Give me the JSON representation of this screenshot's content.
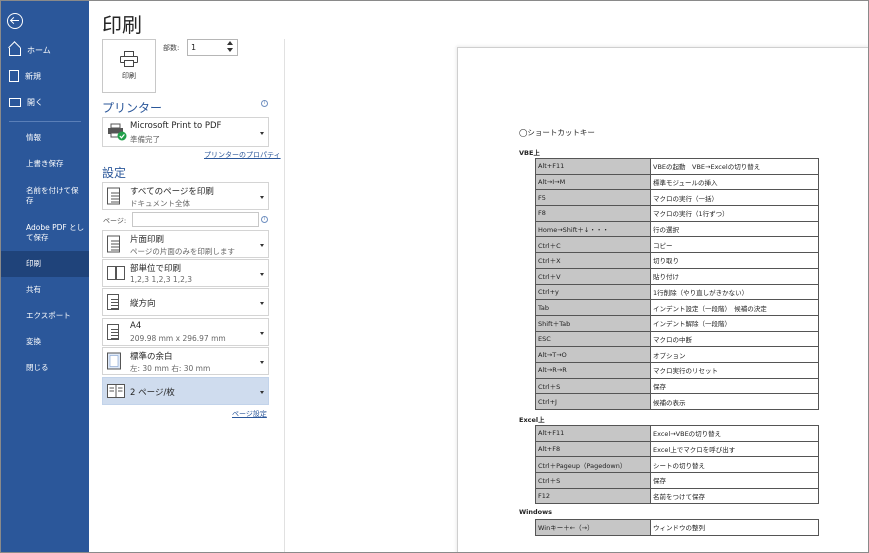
{
  "sidebar": {
    "top_items": [
      {
        "label": "ホーム",
        "icon": "home-icon"
      },
      {
        "label": "新規",
        "icon": "new-document-icon"
      },
      {
        "label": "開く",
        "icon": "folder-open-icon"
      }
    ],
    "items": [
      {
        "label": "情報"
      },
      {
        "label": "上書き保存"
      },
      {
        "label": "名前を付けて保存"
      },
      {
        "label": "Adobe PDF として保存"
      },
      {
        "label": "印刷",
        "active": true
      },
      {
        "label": "共有"
      },
      {
        "label": "エクスポート"
      },
      {
        "label": "変換"
      },
      {
        "label": "閉じる"
      }
    ],
    "bg_color": "#2b579a",
    "active_color": "#1f437a"
  },
  "page_title": "印刷",
  "print_button": {
    "label": "印刷"
  },
  "copies": {
    "label": "部数:",
    "value": "1"
  },
  "printer": {
    "section_title": "プリンター",
    "name": "Microsoft Print to PDF",
    "status": "準備完了",
    "properties_link": "プリンターのプロパティ"
  },
  "settings": {
    "section_title": "設定",
    "pages_label": "ページ:",
    "pages_value": "",
    "page_setup_link": "ページ設定",
    "options": [
      {
        "title": "すべてのページを印刷",
        "subtitle": "ドキュメント全体"
      },
      {
        "title": "片面印刷",
        "subtitle": "ページの片面のみを印刷します"
      },
      {
        "title": "部単位で印刷",
        "subtitle": "1,2,3    1,2,3    1,2,3"
      },
      {
        "title": "縦方向",
        "subtitle": ""
      },
      {
        "title": "A4",
        "subtitle": "209.98 mm x 296.97 mm"
      },
      {
        "title": "標準の余白",
        "subtitle": "左:   30 mm    右:   30 mm"
      },
      {
        "title": "2 ページ/枚",
        "subtitle": ""
      }
    ]
  },
  "preview": {
    "doc_title": "◯ショートカットキー",
    "sections": [
      {
        "heading": "VBE上",
        "rows": [
          {
            "key": "Alt+F11",
            "desc": "VBEの起動　VBE→Excelの切り替え"
          },
          {
            "key": "Alt→I→M",
            "desc": "標準モジュールの挿入"
          },
          {
            "key": "F5",
            "desc": "マクロの実行（一括）"
          },
          {
            "key": "F8",
            "desc": "マクロの実行（1行ずつ）"
          },
          {
            "key": "Home→Shift＋↓・・・",
            "desc": "行の選択"
          },
          {
            "key": "Ctrl＋C",
            "desc": "コピー"
          },
          {
            "key": "Ctrl＋X",
            "desc": "切り取り"
          },
          {
            "key": "Ctrl＋V",
            "desc": "貼り付け"
          },
          {
            "key": "Ctrl+y",
            "desc": "1行削除（やり直しがきかない）"
          },
          {
            "key": "Tab",
            "desc": "インデント設定（一段階）　候補の決定"
          },
          {
            "key": "Shift＋Tab",
            "desc": "インデント解除（一段階）"
          },
          {
            "key": "ESC",
            "desc": "マクロの中断"
          },
          {
            "key": "Alt→T→O",
            "desc": "オプション"
          },
          {
            "key": "Alt→R→R",
            "desc": "マクロ実行のリセット"
          },
          {
            "key": "Ctrl＋S",
            "desc": "保存"
          },
          {
            "key": "Ctrl+J",
            "desc": "候補の表示"
          }
        ]
      },
      {
        "heading": "Excel上",
        "rows": [
          {
            "key": "Alt+F11",
            "desc": "Excel→VBEの切り替え"
          },
          {
            "key": "Alt+F8",
            "desc": "Excel上でマクロを呼び出す"
          },
          {
            "key": "Ctrl＋Pageup（Pagedown）",
            "desc": "シートの切り替え"
          },
          {
            "key": "Ctrl＋S",
            "desc": "保存"
          },
          {
            "key": "F12",
            "desc": "名前をつけて保存"
          }
        ]
      },
      {
        "heading": "Windows",
        "rows": [
          {
            "key": "Winキー＋←（→）",
            "desc": "ウィンドウの整列"
          }
        ]
      }
    ]
  }
}
